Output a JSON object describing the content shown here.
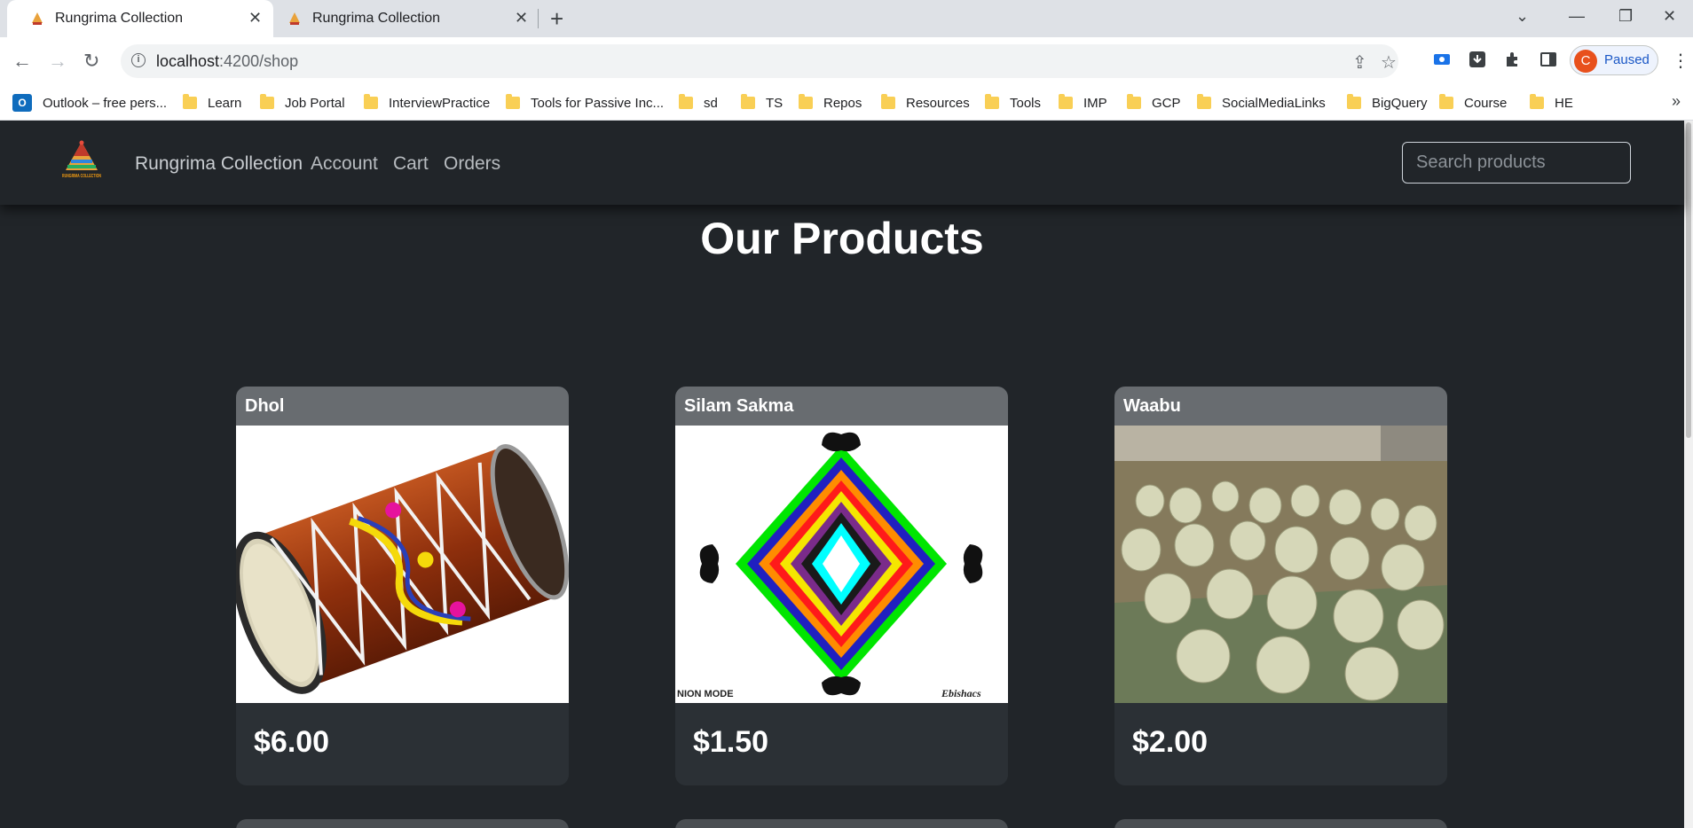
{
  "browser": {
    "tabs": [
      {
        "title": "Rungrima Collection",
        "active": true
      },
      {
        "title": "Rungrima Collection",
        "active": false
      }
    ],
    "url_host": "localhost",
    "url_path": ":4200/shop",
    "profile_initial": "C",
    "profile_status": "Paused",
    "bookmarks": [
      {
        "label": "Outlook – free pers...",
        "icon": "outlook-icon"
      },
      {
        "label": "Learn",
        "icon": "folder-icon"
      },
      {
        "label": "Job Portal",
        "icon": "folder-icon"
      },
      {
        "label": "InterviewPractice",
        "icon": "folder-icon"
      },
      {
        "label": "Tools for Passive Inc...",
        "icon": "folder-icon"
      },
      {
        "label": "sd",
        "icon": "folder-icon"
      },
      {
        "label": "TS",
        "icon": "folder-icon"
      },
      {
        "label": "Repos",
        "icon": "folder-icon"
      },
      {
        "label": "Resources",
        "icon": "folder-icon"
      },
      {
        "label": "Tools",
        "icon": "folder-icon"
      },
      {
        "label": "IMP",
        "icon": "folder-icon"
      },
      {
        "label": "GCP",
        "icon": "folder-icon"
      },
      {
        "label": "SocialMediaLinks",
        "icon": "folder-icon"
      },
      {
        "label": "BigQuery",
        "icon": "folder-icon"
      },
      {
        "label": "Course",
        "icon": "folder-icon"
      },
      {
        "label": "HE",
        "icon": "folder-icon"
      }
    ]
  },
  "site": {
    "brand": "Rungrima Collection",
    "logo_text": "RUNGRIMA COLLECTION",
    "nav": {
      "account": "Account",
      "cart": "Cart",
      "orders": "Orders"
    },
    "search_placeholder": "Search products"
  },
  "page": {
    "title": "Our Products"
  },
  "products": [
    {
      "name": "Dhol",
      "price": "$6.00",
      "image": "dhol-drum"
    },
    {
      "name": "Silam Sakma",
      "price": "$1.50",
      "image": "silam-sakma-pattern",
      "image_caption_left": "NION MODE",
      "image_caption_right": "Ebishacs"
    },
    {
      "name": "Waabu",
      "price": "$2.00",
      "image": "gourds"
    }
  ],
  "colors": {
    "page_bg": "#212529",
    "card_header": "#686c70",
    "card_body": "#2b3035"
  }
}
